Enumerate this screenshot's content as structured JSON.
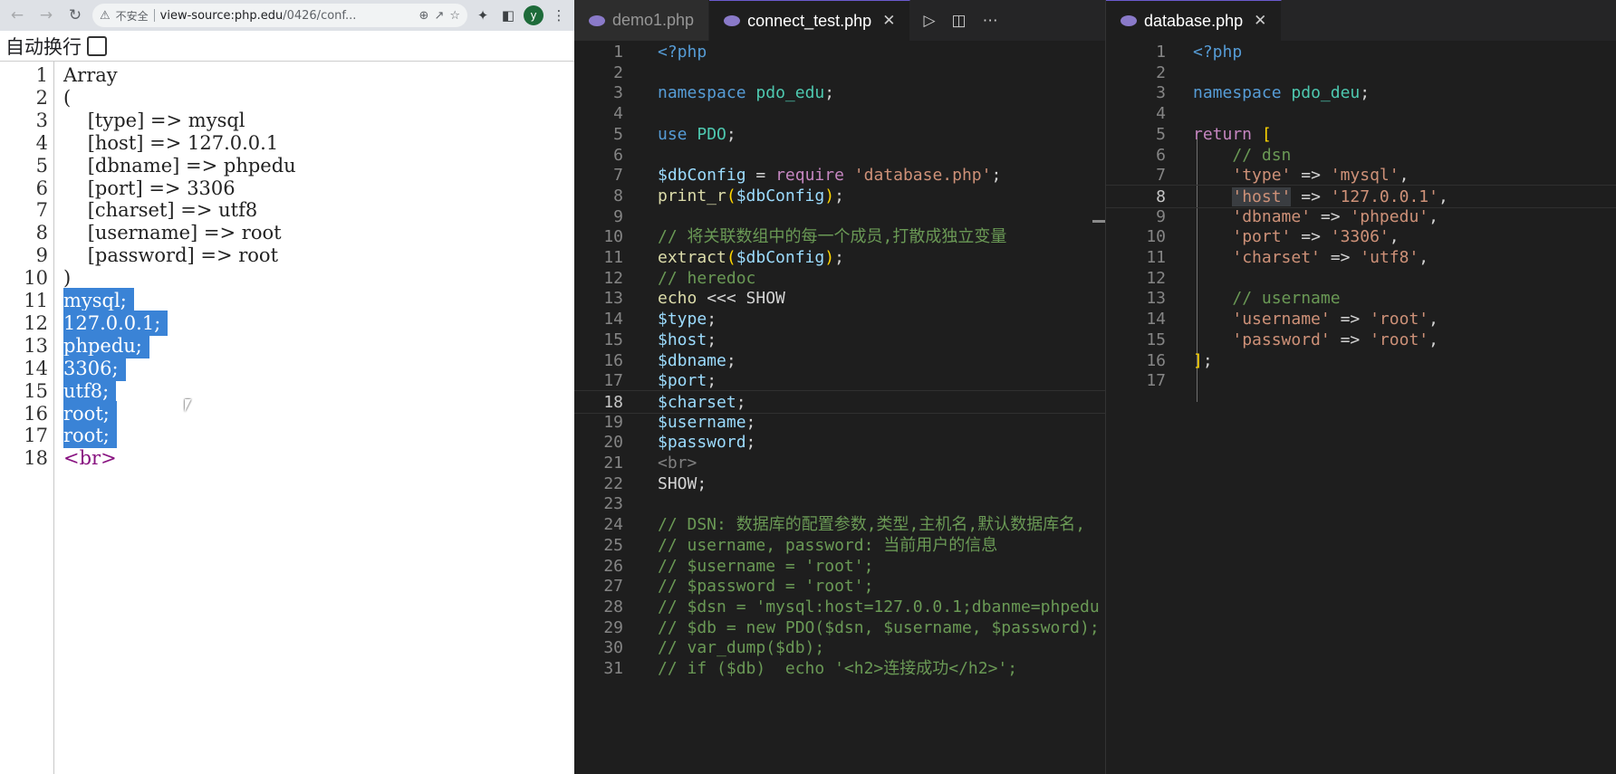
{
  "browser": {
    "insecure_label": "不安全",
    "url_host": "view-source:php.edu",
    "url_path": "/0426/conf...",
    "profile_initial": "y",
    "wrap_label": "自动换行",
    "source_lines": [
      {
        "n": "1",
        "text": "Array"
      },
      {
        "n": "2",
        "text": "("
      },
      {
        "n": "3",
        "text": "    [type] => mysql"
      },
      {
        "n": "4",
        "text": "    [host] => 127.0.0.1"
      },
      {
        "n": "5",
        "text": "    [dbname] => phpedu"
      },
      {
        "n": "6",
        "text": "    [port] => 3306"
      },
      {
        "n": "7",
        "text": "    [charset] => utf8"
      },
      {
        "n": "8",
        "text": "    [username] => root"
      },
      {
        "n": "9",
        "text": "    [password] => root"
      },
      {
        "n": "10",
        "text": ")"
      },
      {
        "n": "11",
        "text": "mysql;"
      },
      {
        "n": "12",
        "text": "127.0.0.1;"
      },
      {
        "n": "13",
        "text": "phpedu;"
      },
      {
        "n": "14",
        "text": "3306;"
      },
      {
        "n": "15",
        "text": "utf8;"
      },
      {
        "n": "16",
        "text": "root;"
      },
      {
        "n": "17",
        "text": "root;"
      },
      {
        "n": "18",
        "text": "<br>"
      }
    ]
  },
  "editor1": {
    "tabs": [
      "demo1.php",
      "connect_test.php"
    ],
    "active_tab": "connect_test.php",
    "lines": [
      {
        "n": "1",
        "text": "<?php"
      },
      {
        "n": "2",
        "text": ""
      },
      {
        "n": "3",
        "text": "namespace pdo_edu;"
      },
      {
        "n": "4",
        "text": ""
      },
      {
        "n": "5",
        "text": "use PDO;"
      },
      {
        "n": "6",
        "text": ""
      },
      {
        "n": "7",
        "text": "$dbConfig = require 'database.php';"
      },
      {
        "n": "8",
        "text": "print_r($dbConfig);"
      },
      {
        "n": "9",
        "text": ""
      },
      {
        "n": "10",
        "text": "// 将关联数组中的每一个成员,打散成独立变量"
      },
      {
        "n": "11",
        "text": "extract($dbConfig);"
      },
      {
        "n": "12",
        "text": "// heredoc"
      },
      {
        "n": "13",
        "text": "echo <<< SHOW"
      },
      {
        "n": "14",
        "text": "$type;"
      },
      {
        "n": "15",
        "text": "$host;"
      },
      {
        "n": "16",
        "text": "$dbname;"
      },
      {
        "n": "17",
        "text": "$port;"
      },
      {
        "n": "18",
        "text": "$charset;"
      },
      {
        "n": "19",
        "text": "$username;"
      },
      {
        "n": "20",
        "text": "$password;"
      },
      {
        "n": "21",
        "text": "<br>"
      },
      {
        "n": "22",
        "text": "SHOW;"
      },
      {
        "n": "23",
        "text": ""
      },
      {
        "n": "24",
        "text": "// DSN: 数据库的配置参数,类型,主机名,默认数据库名,"
      },
      {
        "n": "25",
        "text": "// username, password: 当前用户的信息"
      },
      {
        "n": "26",
        "text": "// $username = 'root';"
      },
      {
        "n": "27",
        "text": "// $password = 'root';"
      },
      {
        "n": "28",
        "text": "// $dsn = 'mysql:host=127.0.0.1;dbanme=phpedu"
      },
      {
        "n": "29",
        "text": "// $db = new PDO($dsn, $username, $password);"
      },
      {
        "n": "30",
        "text": "// var_dump($db);"
      },
      {
        "n": "31",
        "text": "// if ($db)  echo '<h2>连接成功</h2>';"
      }
    ]
  },
  "editor2": {
    "tabs": [
      "database.php"
    ],
    "active_tab": "database.php",
    "lines": [
      {
        "n": "1",
        "text": "<?php"
      },
      {
        "n": "2",
        "text": ""
      },
      {
        "n": "3",
        "text": "namespace pdo_deu;"
      },
      {
        "n": "4",
        "text": ""
      },
      {
        "n": "5",
        "text": "return ["
      },
      {
        "n": "6",
        "text": "    // dsn"
      },
      {
        "n": "7",
        "text": "    'type' => 'mysql',"
      },
      {
        "n": "8",
        "text": "    'host' => '127.0.0.1',"
      },
      {
        "n": "9",
        "text": "    'dbname' => 'phpedu',"
      },
      {
        "n": "10",
        "text": "    'port' => '3306',"
      },
      {
        "n": "11",
        "text": "    'charset' => 'utf8',"
      },
      {
        "n": "12",
        "text": ""
      },
      {
        "n": "13",
        "text": "    // username"
      },
      {
        "n": "14",
        "text": "    'username' => 'root',"
      },
      {
        "n": "15",
        "text": "    'password' => 'root',"
      },
      {
        "n": "16",
        "text": "];"
      },
      {
        "n": "17",
        "text": ""
      }
    ]
  },
  "colors": {
    "selection": "#3a83d6",
    "editor_bg": "#1e1e1e",
    "comment": "#6a9955",
    "keyword": "#569cd6",
    "string": "#ce9178",
    "variable": "#9cdcfe"
  }
}
